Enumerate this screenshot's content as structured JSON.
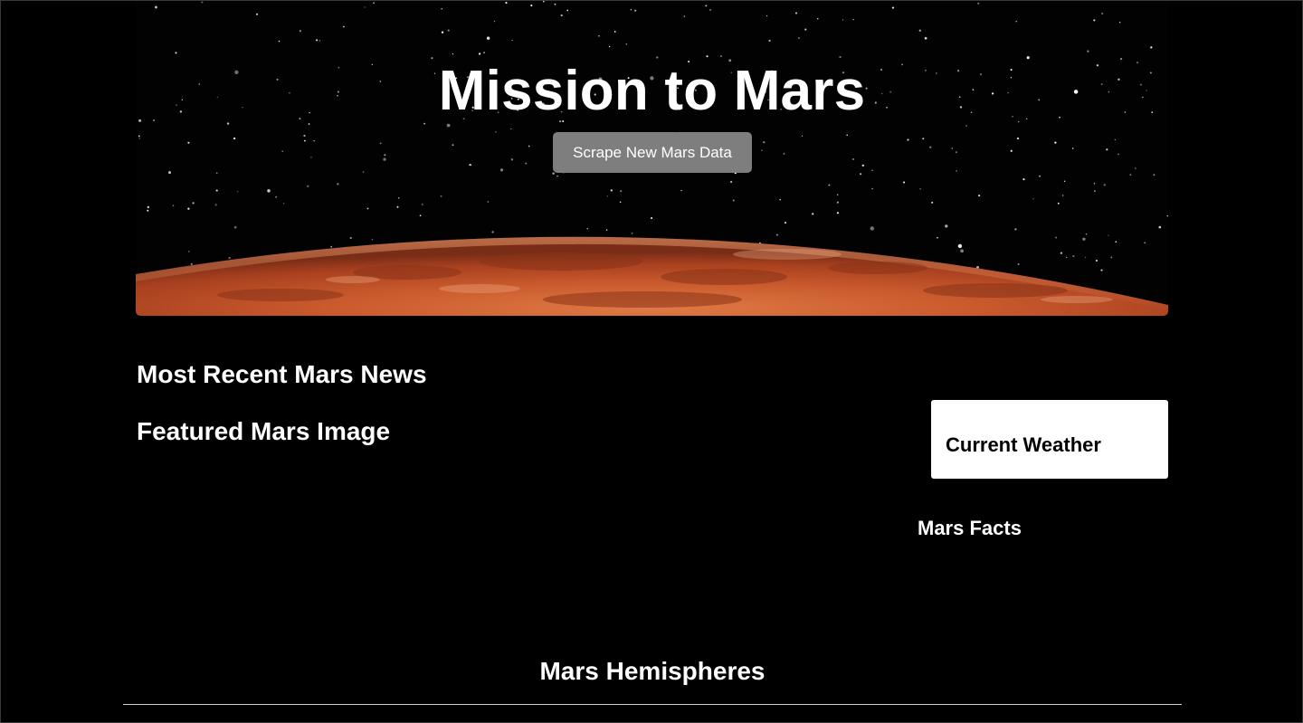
{
  "hero": {
    "title": "Mission to Mars",
    "scrape_button_label": "Scrape New Mars Data",
    "background": "starfield-mars-horizon-image"
  },
  "sections": {
    "news_title": "Most Recent Mars News",
    "featured_image_title": "Featured Mars Image",
    "weather_title": "Current Weather",
    "facts_title": "Mars Facts",
    "hemispheres_title": "Mars Hemispheres"
  },
  "colors": {
    "page_background": "#000000",
    "button_background": "#7e7e7e",
    "weather_card_background": "#ffffff",
    "mars_surface": "#c4552c"
  }
}
